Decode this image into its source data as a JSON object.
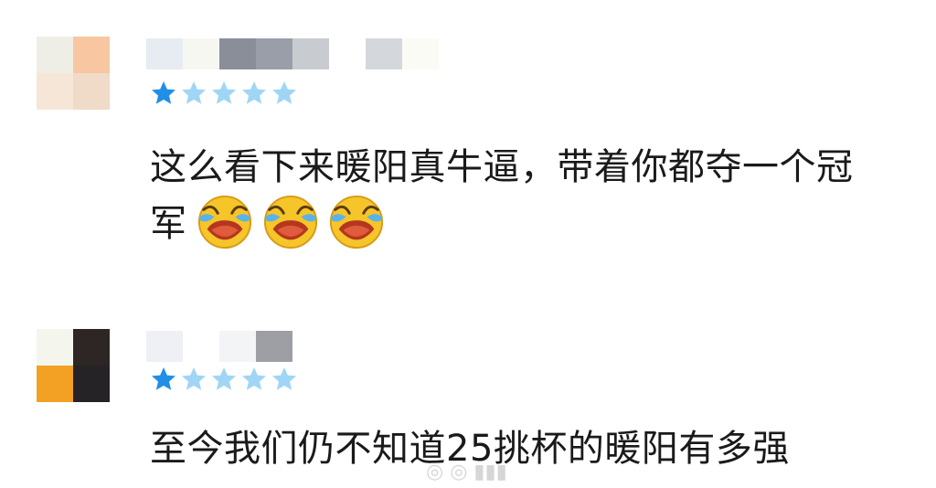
{
  "comments": [
    {
      "rating": 1,
      "max_rating": 5,
      "text_line1": "这么看下来暖阳真牛逼，带着你都夺一个冠",
      "text_line2": "军",
      "emoji": "laughing-crying-emoji",
      "emoji_count": 3
    },
    {
      "rating": 1,
      "max_rating": 5,
      "text_line1": "至今我们仍不知道25挑杯的暖阳有多强"
    }
  ],
  "colors": {
    "star_filled": "#1f8fe8",
    "star_empty": "#9fd6f6",
    "text": "#1a1a1a"
  }
}
